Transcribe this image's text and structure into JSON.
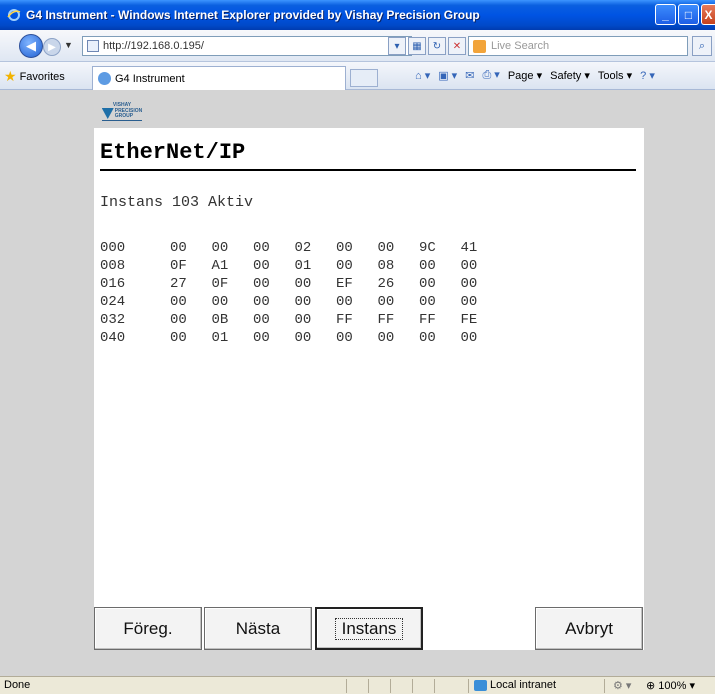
{
  "window": {
    "title": "G4 Instrument - Windows Internet Explorer provided by Vishay Precision Group",
    "controls": {
      "minimize": "_",
      "maximize": "□",
      "close": "X"
    }
  },
  "browser": {
    "address": "http://192.168.0.195/",
    "search_placeholder": "Live Search",
    "favorites_label": "Favorites",
    "tab_title": "G4 Instrument",
    "commands": {
      "page": "Page",
      "safety": "Safety",
      "tools": "Tools"
    }
  },
  "page": {
    "logo_lines": [
      "VISHAY",
      "PRECISION",
      "GROUP"
    ],
    "title": "EtherNet/IP",
    "status_line": "Instans 103 Aktiv",
    "hex_rows": [
      {
        "offset": "000",
        "bytes": [
          "00",
          "00",
          "00",
          "02",
          "00",
          "00",
          "9C",
          "41"
        ]
      },
      {
        "offset": "008",
        "bytes": [
          "0F",
          "A1",
          "00",
          "01",
          "00",
          "08",
          "00",
          "00"
        ]
      },
      {
        "offset": "016",
        "bytes": [
          "27",
          "0F",
          "00",
          "00",
          "EF",
          "26",
          "00",
          "00"
        ]
      },
      {
        "offset": "024",
        "bytes": [
          "00",
          "00",
          "00",
          "00",
          "00",
          "00",
          "00",
          "00"
        ]
      },
      {
        "offset": "032",
        "bytes": [
          "00",
          "0B",
          "00",
          "00",
          "FF",
          "FF",
          "FF",
          "FE"
        ]
      },
      {
        "offset": "040",
        "bytes": [
          "00",
          "01",
          "00",
          "00",
          "00",
          "00",
          "00",
          "00"
        ]
      }
    ],
    "buttons": {
      "prev": "Föreg.",
      "next": "Nästa",
      "instance": "Instans",
      "cancel": "Avbryt"
    }
  },
  "statusbar": {
    "state": "Done",
    "zone": "Local intranet",
    "zoom": "100%"
  },
  "colors": {
    "titlebar": "#0054e3",
    "chrome": "#ece9d8",
    "page_background": "#d4d4d4",
    "panel": "#ffffff"
  }
}
